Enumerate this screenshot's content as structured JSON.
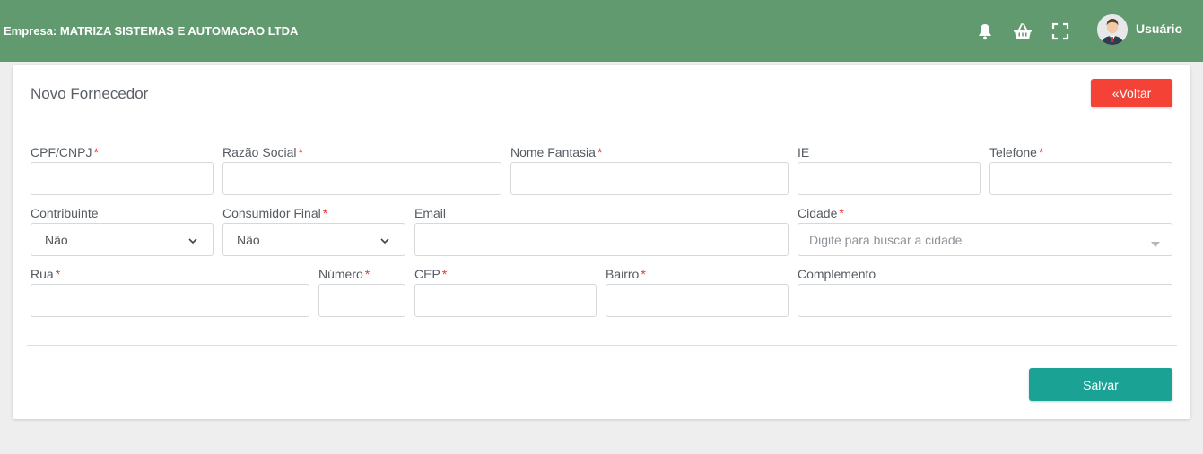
{
  "header": {
    "empresa": "Empresa: MATRIZA SISTEMAS E AUTOMACAO LTDA",
    "user_name": "Usuário",
    "bg_color": "#629a6f",
    "icons": [
      "bell-icon",
      "basket-icon",
      "fullscreen-icon"
    ]
  },
  "page": {
    "title": "Novo Fornecedor",
    "back_button": "«Voltar",
    "save_button": "Salvar"
  },
  "form": {
    "required_mark": "*",
    "cpf": {
      "label": "CPF/CNPJ",
      "value": ""
    },
    "razao": {
      "label": "Razão Social",
      "value": ""
    },
    "fantasia": {
      "label": "Nome Fantasia",
      "value": ""
    },
    "ie": {
      "label": "IE",
      "value": ""
    },
    "telefone": {
      "label": "Telefone",
      "value": ""
    },
    "contribuinte": {
      "label": "Contribuinte",
      "value": "Não"
    },
    "consumidor": {
      "label": "Consumidor Final",
      "value": "Não"
    },
    "email": {
      "label": "Email",
      "value": ""
    },
    "cidade": {
      "label": "Cidade",
      "placeholder": "Digite para buscar a cidade"
    },
    "rua": {
      "label": "Rua",
      "value": ""
    },
    "numero": {
      "label": "Número",
      "value": ""
    },
    "cep": {
      "label": "CEP",
      "value": ""
    },
    "bairro": {
      "label": "Bairro",
      "value": ""
    },
    "complemento": {
      "label": "Complemento",
      "value": ""
    }
  },
  "colors": {
    "danger": "#f44336",
    "primary": "#1aa394",
    "required": "#e53935"
  }
}
